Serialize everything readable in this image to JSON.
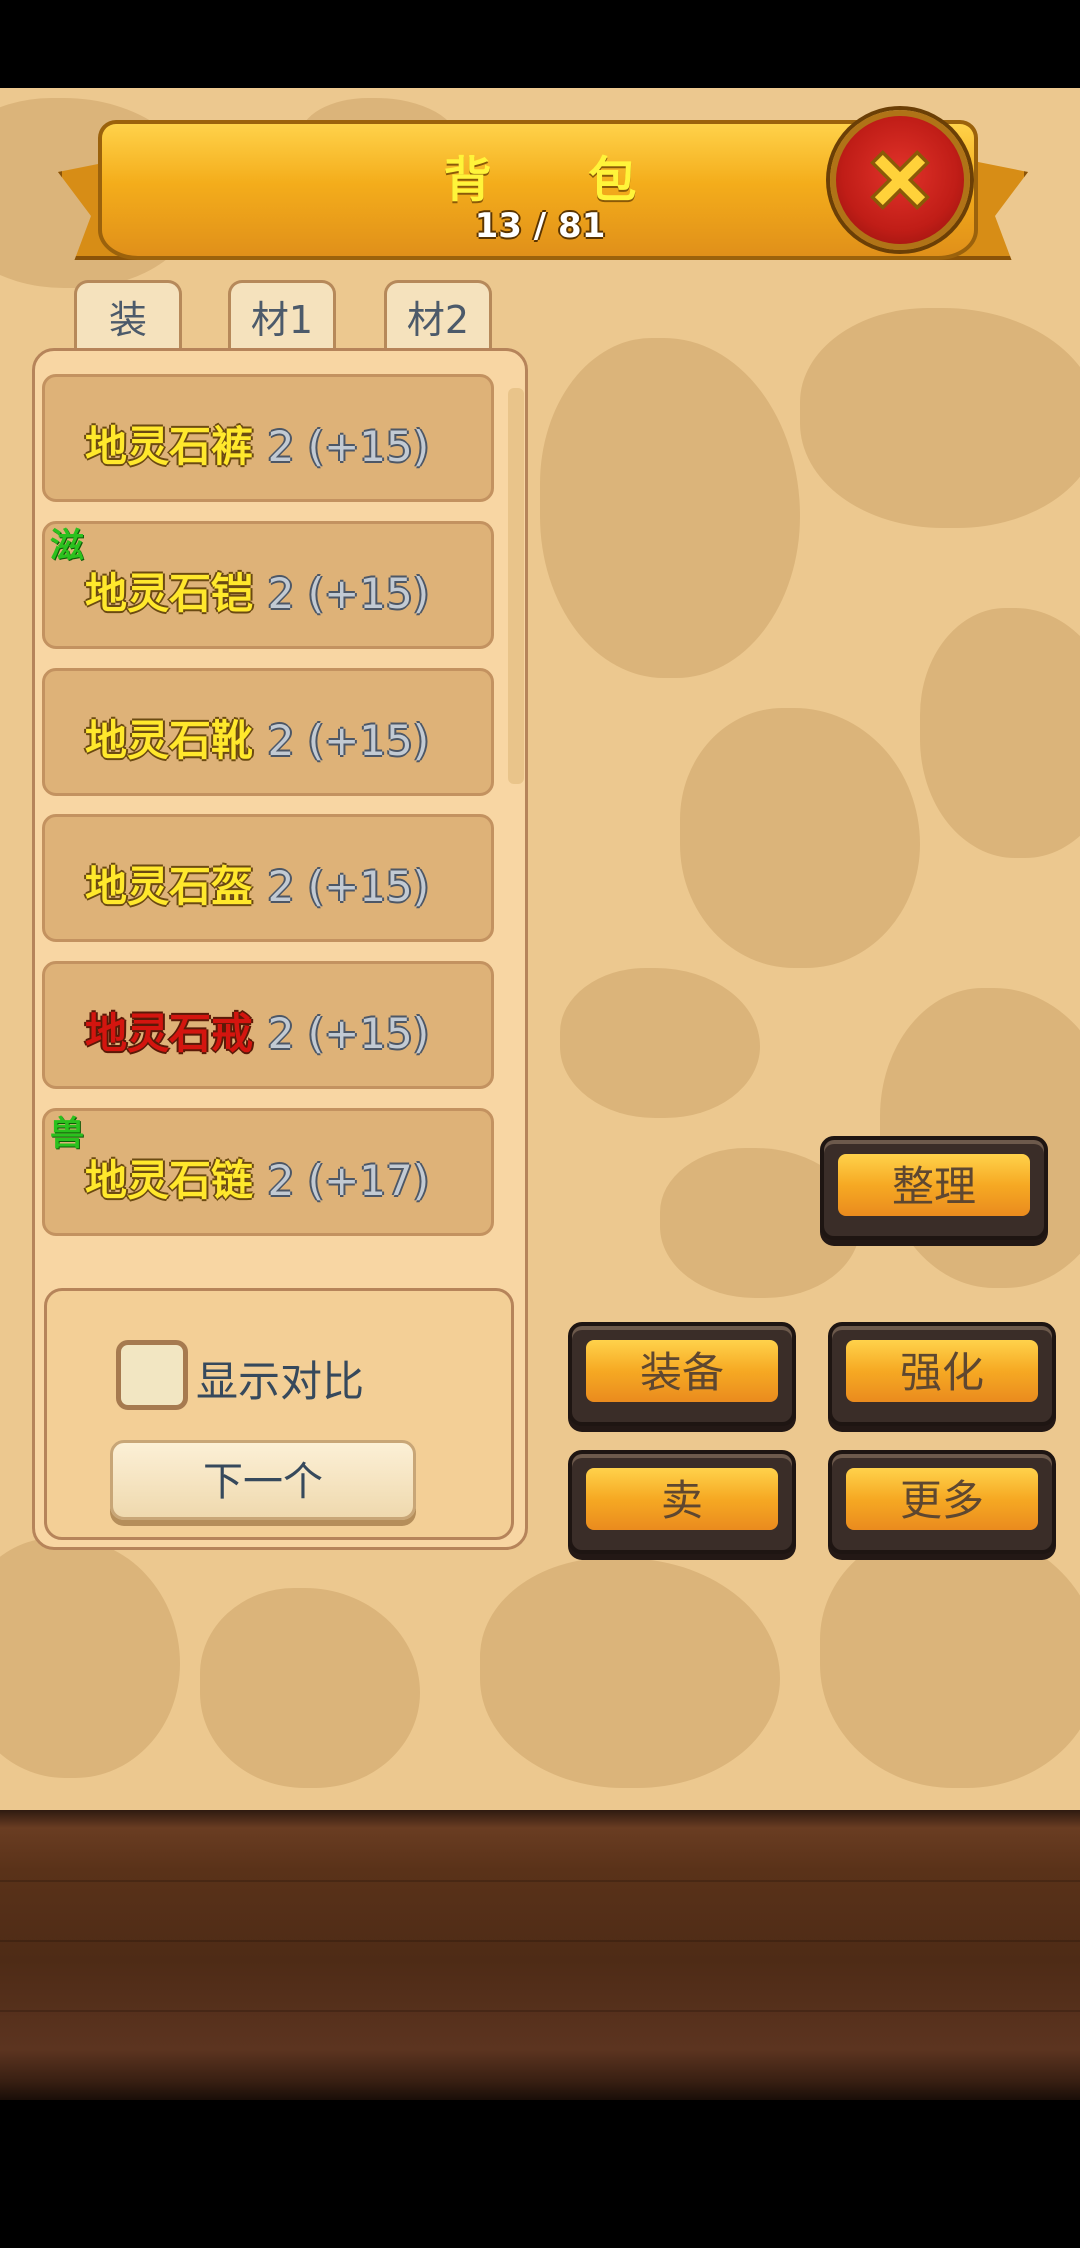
{
  "header": {
    "title": "背 包",
    "count": "13 / 81"
  },
  "tabs": [
    {
      "label": "装"
    },
    {
      "label": "材1"
    },
    {
      "label": "材2"
    }
  ],
  "items": [
    {
      "name": "地灵石裤",
      "level": "2 (+15)",
      "tag": "",
      "name_color": "#ffe82c"
    },
    {
      "name": "地灵石铠",
      "level": "2 (+15)",
      "tag": "滋",
      "name_color": "#ffe82c"
    },
    {
      "name": "地灵石靴",
      "level": "2 (+15)",
      "tag": "",
      "name_color": "#ffe82c"
    },
    {
      "name": "地灵石盔",
      "level": "2 (+15)",
      "tag": "",
      "name_color": "#ffe82c"
    },
    {
      "name": "地灵石戒",
      "level": "2 (+15)",
      "tag": "",
      "name_color": "#d4150f"
    },
    {
      "name": "地灵石链",
      "level": "2 (+17)",
      "tag": "兽",
      "name_color": "#ffe82c"
    }
  ],
  "compare": {
    "label": "显示对比",
    "checked": false,
    "next_label": "下一个"
  },
  "actions": {
    "sort": "整理",
    "equip": "装备",
    "enhance": "强化",
    "sell": "卖",
    "more": "更多"
  },
  "colors": {
    "accent": "#f6a923",
    "tag_green": "#2bc11e"
  },
  "icons": {
    "close": "close-x-icon"
  }
}
